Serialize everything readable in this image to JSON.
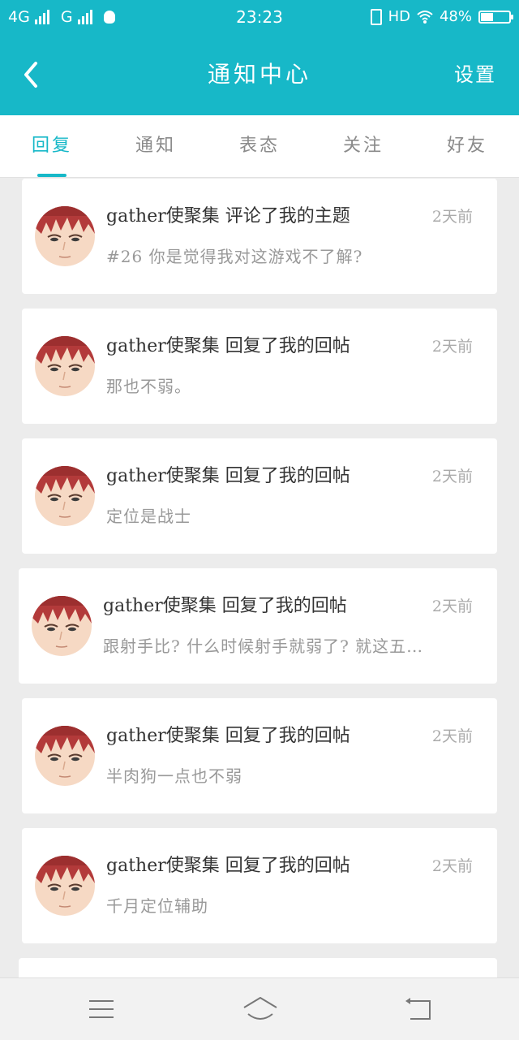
{
  "status_bar": {
    "network1": "4G",
    "network2": "G",
    "time": "23:23",
    "hd": "HD",
    "battery": "48%",
    "battery_level": 0.48
  },
  "header": {
    "title": "通知中心",
    "settings": "设置",
    "back_icon": "chevron-left-icon"
  },
  "tabs": [
    {
      "label": "回复",
      "active": true
    },
    {
      "label": "通知",
      "active": false
    },
    {
      "label": "表态",
      "active": false
    },
    {
      "label": "关注",
      "active": false
    },
    {
      "label": "好友",
      "active": false
    }
  ],
  "items": [
    {
      "title": "gather使聚集 评论了我的主题",
      "time": "2天前",
      "body": "#26 你是觉得我对这游戏不了解?"
    },
    {
      "title": "gather使聚集 回复了我的回帖",
      "time": "2天前",
      "body": "那也不弱。"
    },
    {
      "title": "gather使聚集 回复了我的回帖",
      "time": "2天前",
      "body": "定位是战士"
    },
    {
      "title": "gather使聚集 回复了我的回帖",
      "time": "2天前",
      "body": "跟射手比? 什么时候射手就弱了? 就这五…"
    },
    {
      "title": "gather使聚集 回复了我的回帖",
      "time": "2天前",
      "body": "半肉狗一点也不弱"
    },
    {
      "title": "gather使聚集 回复了我的回帖",
      "time": "2天前",
      "body": "千月定位辅助"
    }
  ],
  "colors": {
    "accent": "#17b8c8",
    "background": "#ececec"
  },
  "nav_icons": [
    "menu-icon",
    "home-icon",
    "back-icon"
  ]
}
